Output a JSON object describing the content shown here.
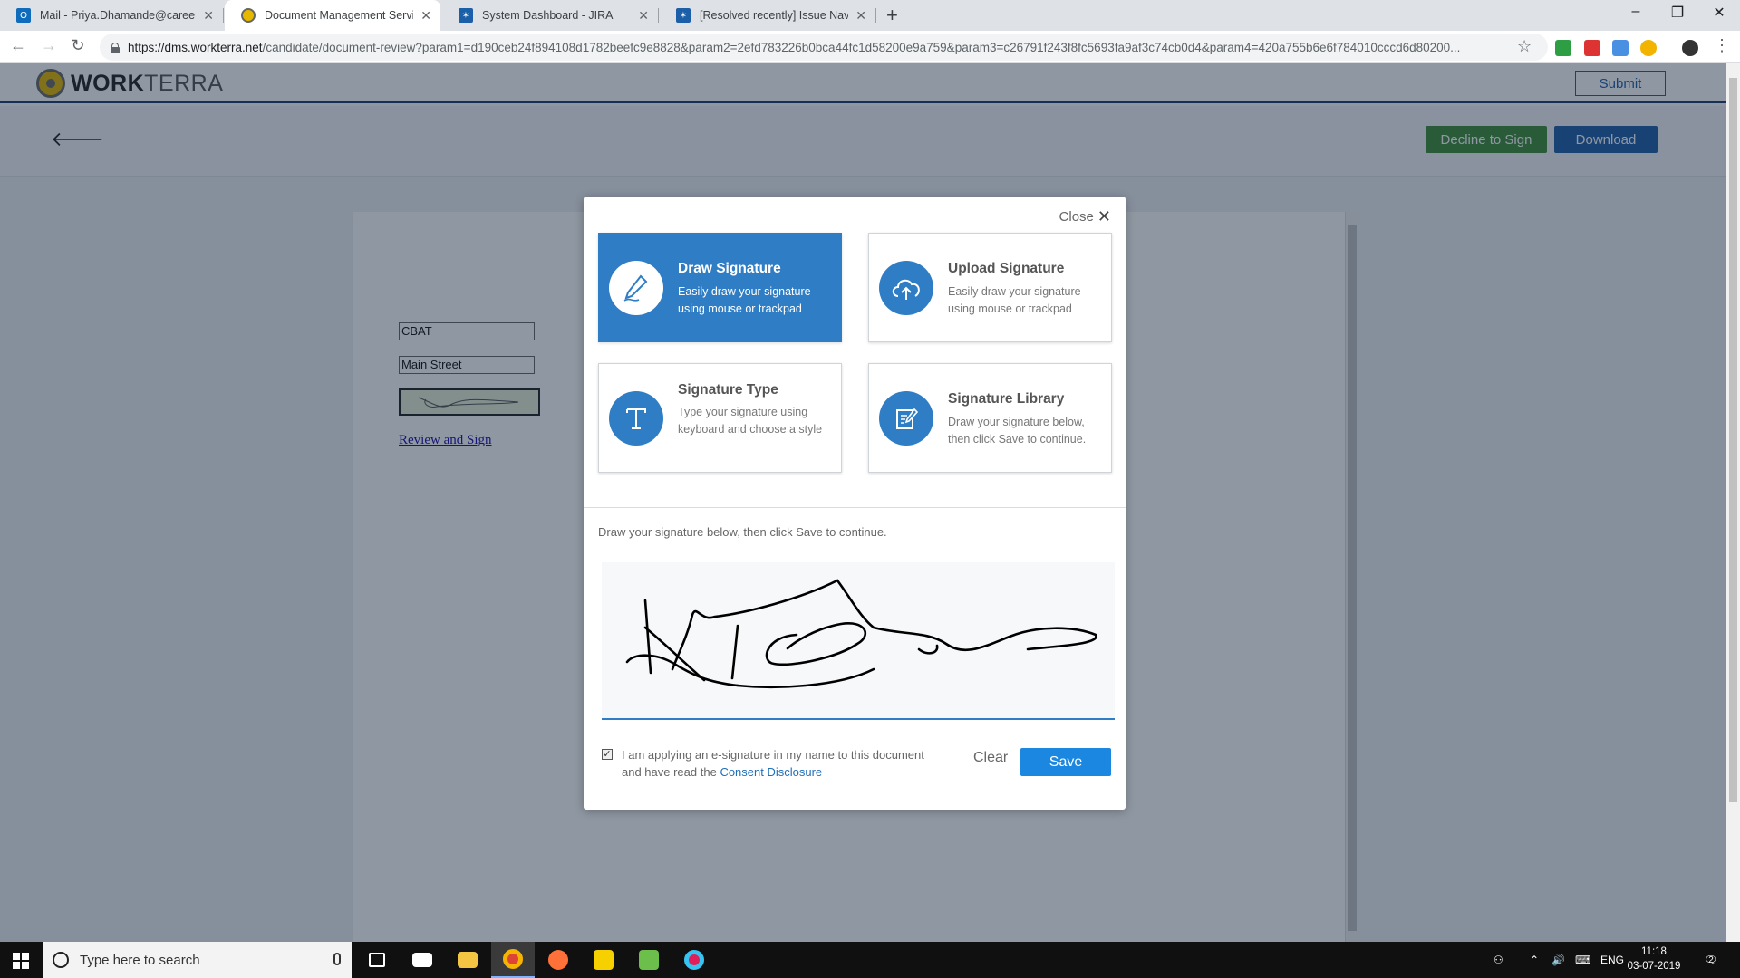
{
  "browser": {
    "tabs": [
      {
        "title": "Mail - Priya.Dhamande@careerb",
        "icon": "outlook-icon",
        "active": false
      },
      {
        "title": "Document Management Service",
        "icon": "workterra-icon",
        "active": true
      },
      {
        "title": "System Dashboard - JIRA",
        "icon": "jira-icon",
        "active": false
      },
      {
        "title": "[Resolved recently] Issue Navigat",
        "icon": "jira-icon",
        "active": false
      }
    ],
    "url_host": "https://dms.workterra.net",
    "url_rest": "/candidate/document-review?param1=d190ceb24f894108d1782beefc9e8828&param2=2efd783226b0bca44fc1d58200e9a759&param3=c26791f243f8fc5693fa9af3c74cb0d4&param4=420a755b6e6f784010cccd6d80200..."
  },
  "app": {
    "logo_bold": "WORK",
    "logo_light": "TERRA",
    "submit_label": "Submit",
    "decline_label": "Decline to Sign",
    "download_label": "Download"
  },
  "document": {
    "field1": "CBAT",
    "field2": "Main Street",
    "review_link": "Review and Sign"
  },
  "modal": {
    "close_label": "Close",
    "options": [
      {
        "title": "Draw Signature",
        "desc": "Easily draw your signature using mouse or trackpad",
        "icon": "pen-icon",
        "active": true
      },
      {
        "title": "Upload Signature",
        "desc": "Easily draw your signature using mouse or trackpad",
        "icon": "cloud-upload-icon",
        "active": false
      },
      {
        "title": "Signature Type",
        "desc": "Type your signature using keyboard and choose a style",
        "icon": "text-type-icon",
        "active": false
      },
      {
        "title": "Signature Library",
        "desc": "Draw your signature below, then click Save to continue.",
        "icon": "library-icon",
        "active": false
      }
    ],
    "instruction": "Draw your signature below, then click Save to continue.",
    "consent_text": "I am applying an e-signature in my name to this document and have read the",
    "consent_link": "Consent Disclosure",
    "consent_checked": true,
    "clear_label": "Clear",
    "save_label": "Save"
  },
  "taskbar": {
    "search_placeholder": "Type here to search",
    "language": "ENG",
    "time": "11:18",
    "date": "03-07-2019",
    "notifications": "2"
  },
  "colors": {
    "primary_blue": "#2f7dc4",
    "decline_green": "#3f8f3a",
    "download_blue": "#1f5ea8",
    "save_blue": "#1b87e0"
  }
}
